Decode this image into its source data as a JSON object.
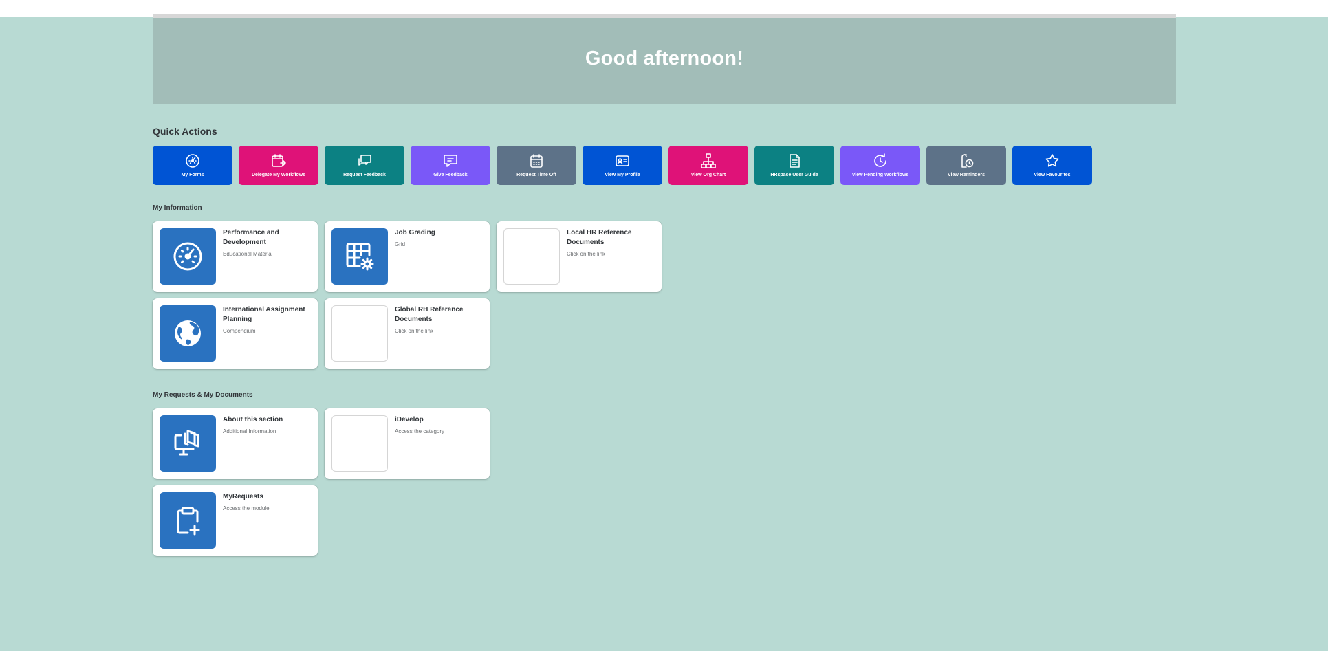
{
  "header": {
    "greeting": "Good afternoon!"
  },
  "quick_actions": {
    "title": "Quick Actions",
    "items": [
      {
        "label": "My Forms",
        "icon": "gauge-icon",
        "color": "#0054d4"
      },
      {
        "label": "Delegate My Workflows",
        "icon": "calendar-delegate-icon",
        "color": "#df1278"
      },
      {
        "label": "Request Feedback",
        "icon": "feedback-chat-icon",
        "color": "#0c8183"
      },
      {
        "label": "Give Feedback",
        "icon": "message-icon",
        "color": "#7a58f8"
      },
      {
        "label": "Request Time Off",
        "icon": "calendar-icon",
        "color": "#5d7288"
      },
      {
        "label": "View My Profile",
        "icon": "id-card-icon",
        "color": "#0054d4"
      },
      {
        "label": "View Org Chart",
        "icon": "org-chart-icon",
        "color": "#df1278"
      },
      {
        "label": "HRspace User Guide",
        "icon": "document-icon",
        "color": "#0c8183"
      },
      {
        "label": "View Pending Workflows",
        "icon": "refresh-clock-icon",
        "color": "#7a58f8"
      },
      {
        "label": "View Reminders",
        "icon": "reminder-icon",
        "color": "#5d7288"
      },
      {
        "label": "View Favourites",
        "icon": "star-icon",
        "color": "#0054d4"
      }
    ]
  },
  "my_information": {
    "title": "My Information",
    "tiles": [
      {
        "title": "Performance and Development",
        "subtitle": "Educational Material",
        "icon": "gauge-icon"
      },
      {
        "title": "Job Grading",
        "subtitle": "Grid",
        "icon": "table-settings-icon"
      },
      {
        "title": "Local HR Reference Documents",
        "subtitle": "Click on the link",
        "icon": ""
      },
      {
        "title": "International Assignment Planning",
        "subtitle": "Compendium",
        "icon": "globe-icon"
      },
      {
        "title": "Global RH Reference Documents",
        "subtitle": "Click on the link",
        "icon": ""
      }
    ]
  },
  "my_requests": {
    "title": "My Requests & My Documents",
    "tiles": [
      {
        "title": "About this section",
        "subtitle": "Additional Information",
        "icon": "monitor-documents-icon"
      },
      {
        "title": "iDevelop",
        "subtitle": "Access the category",
        "icon": ""
      },
      {
        "title": "MyRequests",
        "subtitle": "Access the module",
        "icon": "clipboard-add-icon"
      }
    ]
  },
  "colors": {
    "background": "#b8dad3",
    "hero": "#a2bdb8",
    "tile_icon": "#2a72c0"
  }
}
